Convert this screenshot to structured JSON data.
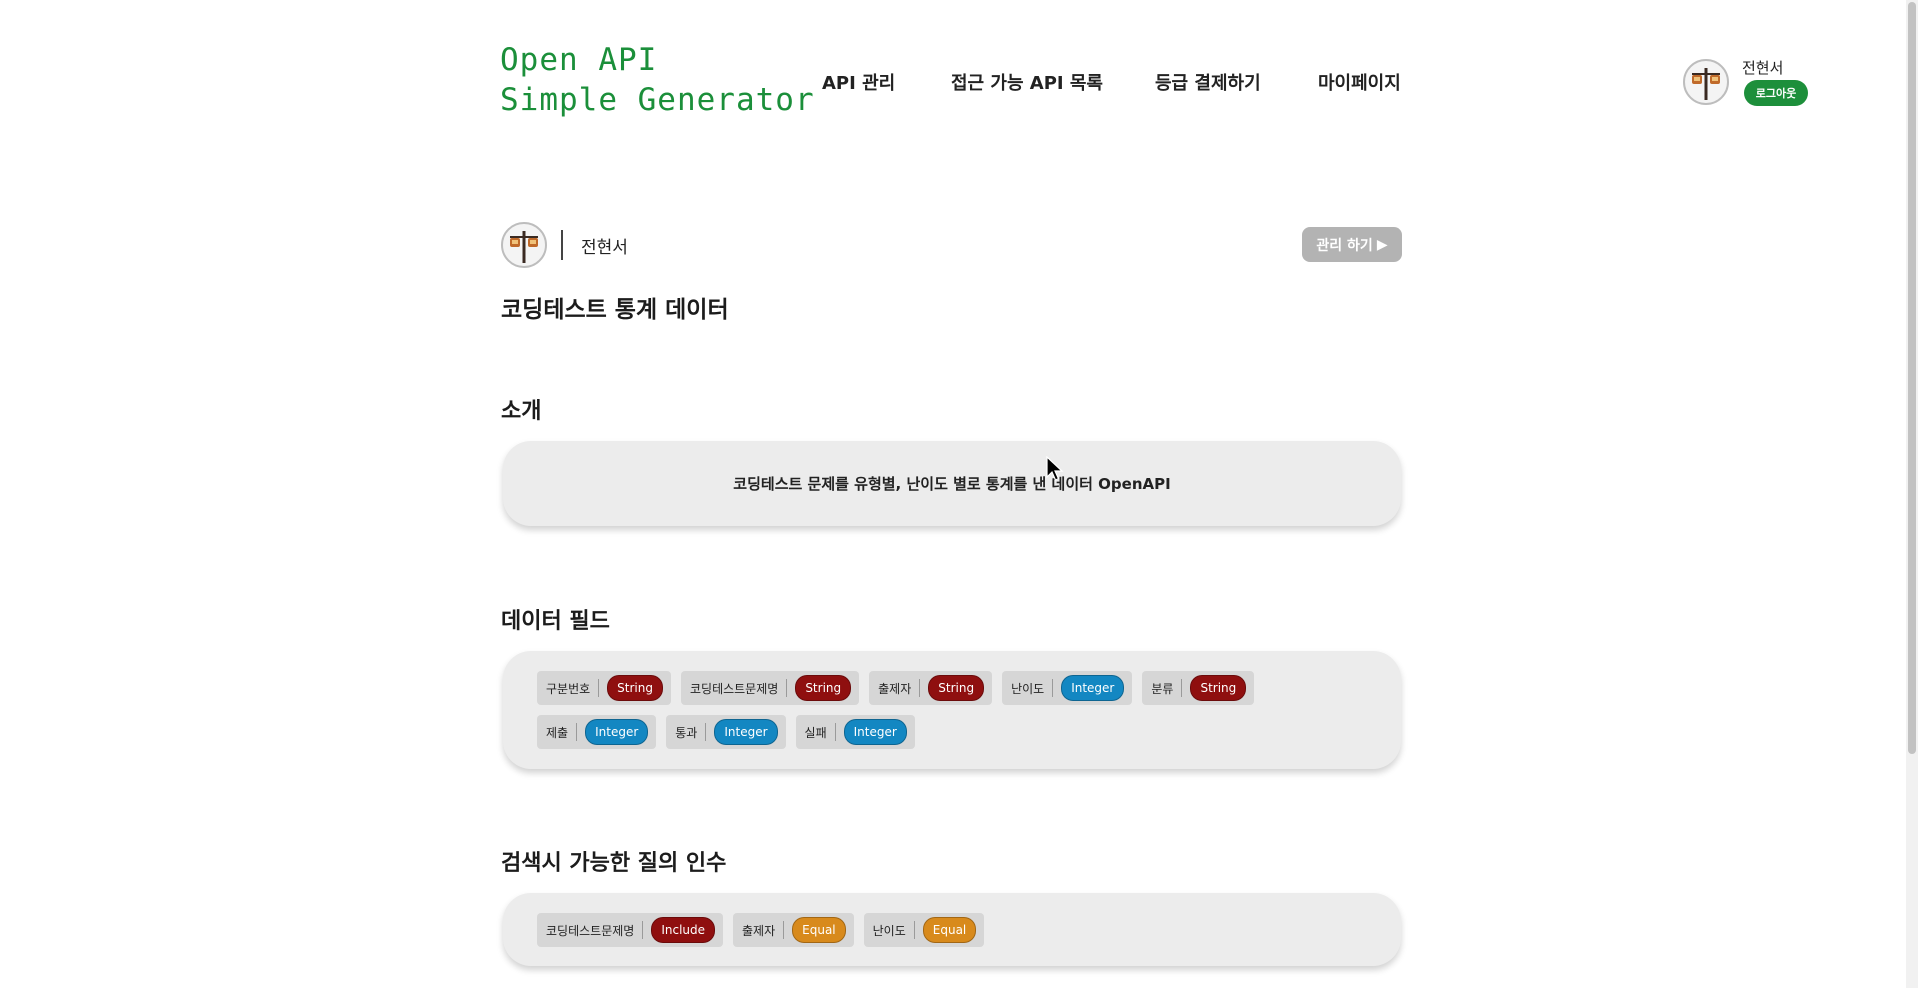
{
  "header": {
    "logo_line1": "Open API",
    "logo_line2": "Simple Generator",
    "nav": [
      "API 관리",
      "접근 가능 API 목록",
      "등급 결제하기",
      "마이페이지"
    ],
    "user_name": "전현서",
    "logout_label": "로그아웃"
  },
  "owner": {
    "name": "전현서",
    "manage_label": "관리 하기",
    "manage_icon": "triangle-right-icon"
  },
  "api": {
    "title": "코딩테스트 통계 데이터"
  },
  "sections": {
    "intro_title": "소개",
    "intro_text": "코딩테스트 문제를 유형별, 난이도 별로 통계를 낸 데이터 OpenAPI",
    "fields_title": "데이터 필드",
    "params_title": "검색시 가능한 질의 인수"
  },
  "fields": [
    {
      "name": "구분번호",
      "type": "String"
    },
    {
      "name": "코딩테스트문제명",
      "type": "String"
    },
    {
      "name": "출제자",
      "type": "String"
    },
    {
      "name": "난이도",
      "type": "Integer"
    },
    {
      "name": "분류",
      "type": "String"
    },
    {
      "name": "제출",
      "type": "Integer"
    },
    {
      "name": "통과",
      "type": "Integer"
    },
    {
      "name": "실패",
      "type": "Integer"
    }
  ],
  "params": [
    {
      "name": "코딩테스트문제명",
      "op": "Include"
    },
    {
      "name": "출제자",
      "op": "Equal"
    },
    {
      "name": "난이도",
      "op": "Equal"
    }
  ],
  "colors": {
    "brand_green": "#1b8f3a",
    "string_red": "#8f0f0f",
    "integer_blue": "#1387c2",
    "equal_orange": "#d88a1c",
    "panel_gray": "#ececec"
  }
}
